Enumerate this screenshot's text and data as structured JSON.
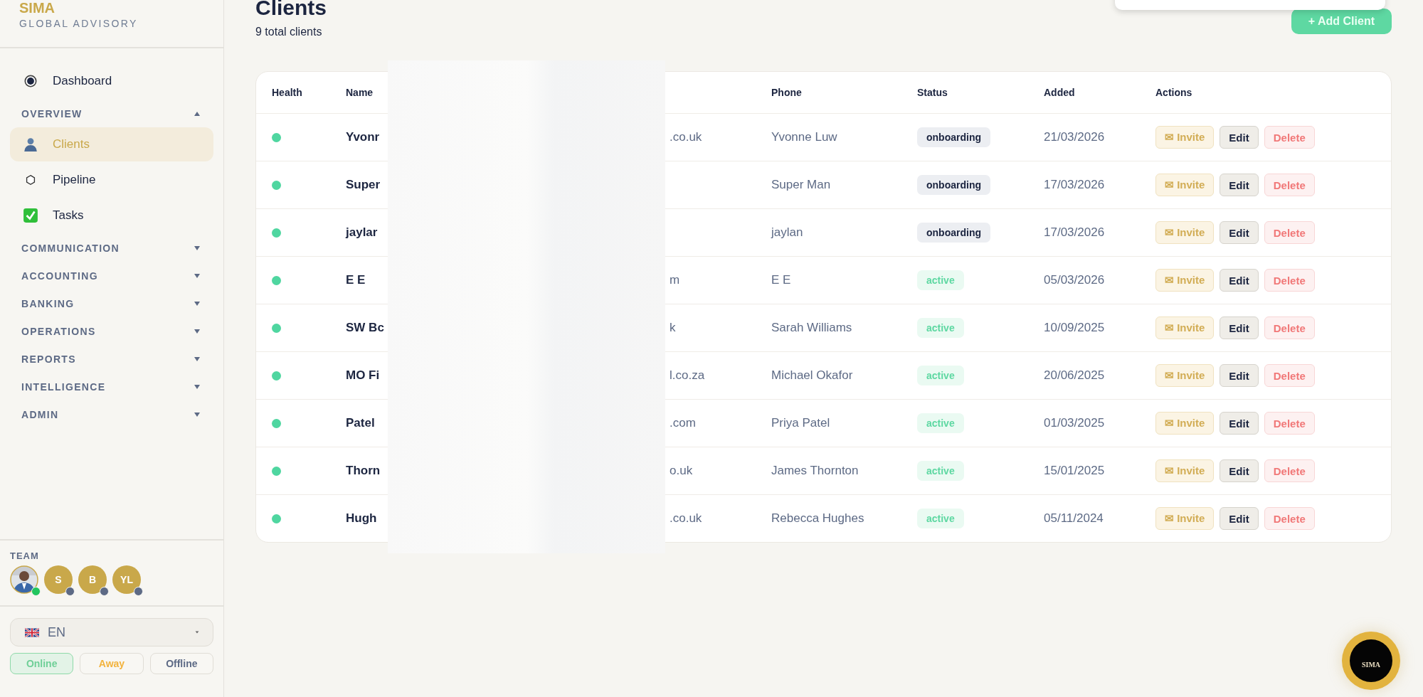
{
  "brand": {
    "name": "SIMA",
    "tagline": "GLOBAL ADVISORY"
  },
  "nav": [
    {
      "kind": "link",
      "label": "Dashboard",
      "selected": false
    },
    {
      "kind": "section",
      "label": "OVERVIEW",
      "expanded": true,
      "children": [
        {
          "label": "Clients",
          "selected": true
        },
        {
          "label": "Pipeline",
          "selected": false
        },
        {
          "label": "Tasks",
          "selected": false
        }
      ]
    },
    {
      "kind": "section",
      "label": "COMMUNICATION",
      "expanded": false
    },
    {
      "kind": "section",
      "label": "ACCOUNTING",
      "expanded": false
    },
    {
      "kind": "section",
      "label": "BANKING",
      "expanded": false
    },
    {
      "kind": "section",
      "label": "OPERATIONS",
      "expanded": false
    },
    {
      "kind": "section",
      "label": "REPORTS",
      "expanded": false
    },
    {
      "kind": "section",
      "label": "INTELLIGENCE",
      "expanded": false
    },
    {
      "kind": "section",
      "label": "ADMIN",
      "expanded": false
    }
  ],
  "team": {
    "label": "TEAM",
    "members": [
      {
        "kind": "picture",
        "online": true
      },
      {
        "kind": "initials",
        "initials": "S",
        "online": false
      },
      {
        "kind": "initials",
        "initials": "B",
        "online": false
      },
      {
        "kind": "initials",
        "initials": "YL",
        "online": false
      }
    ]
  },
  "language": {
    "value": "EN"
  },
  "presence": [
    {
      "kind": "online",
      "label": "Online",
      "selected": true
    },
    {
      "kind": "away",
      "label": "Away",
      "selected": false
    },
    {
      "kind": "offline",
      "label": "Offline",
      "selected": false
    }
  ],
  "page": {
    "title": "Clients",
    "subtitle": "9 total clients",
    "add_button": "+ Add Client"
  },
  "table": {
    "columns": [
      "Health",
      "Name",
      "Phone",
      "Status",
      "Added",
      "Actions"
    ],
    "rows": [
      {
        "name": "Yvonr",
        "column_3": ".co.uk",
        "phone": "Yvonne Luw",
        "status": "onboarding",
        "added": "21/03/2026",
        "actions": [
          "✉ Invite",
          "Edit",
          "Delete"
        ]
      },
      {
        "name": "Super",
        "phone": "Super Man",
        "status": "onboarding",
        "added": "17/03/2026",
        "actions": [
          "✉ Invite",
          "Edit",
          "Delete"
        ]
      },
      {
        "name": "jaylar",
        "phone": "jaylan",
        "status": "onboarding",
        "added": "17/03/2026",
        "actions": [
          "✉ Invite",
          "Edit",
          "Delete"
        ]
      },
      {
        "name": "E E",
        "column_3": "m",
        "phone": "E E",
        "status": "active",
        "added": "05/03/2026",
        "actions": [
          "✉ Invite",
          "Edit",
          "Delete"
        ]
      },
      {
        "name": "SW Bc",
        "column_3": "k",
        "phone": "Sarah Williams",
        "status": "active",
        "added": "10/09/2025",
        "actions": [
          "✉ Invite",
          "Edit",
          "Delete"
        ]
      },
      {
        "name": "MO Fi",
        "column_3": "l.co.za",
        "phone": "Michael Okafor",
        "status": "active",
        "added": "20/06/2025",
        "actions": [
          "✉ Invite",
          "Edit",
          "Delete"
        ]
      },
      {
        "name": "Patel",
        "column_3": ".com",
        "phone": "Priya Patel",
        "status": "active",
        "added": "01/03/2025",
        "actions": [
          "✉ Invite",
          "Edit",
          "Delete"
        ]
      },
      {
        "name": "Thorn",
        "column_3": "o.uk",
        "phone": "James Thornton",
        "status": "active",
        "added": "15/01/2025",
        "actions": [
          "✉ Invite",
          "Edit",
          "Delete"
        ]
      },
      {
        "name": "Hugh",
        "column_3": ".co.uk",
        "phone": "Rebecca Hughes",
        "status": "active",
        "added": "05/11/2024",
        "actions": [
          "✉ Invite",
          "Edit",
          "Delete"
        ]
      }
    ]
  },
  "fab": {
    "logo_text": "SIMA"
  }
}
